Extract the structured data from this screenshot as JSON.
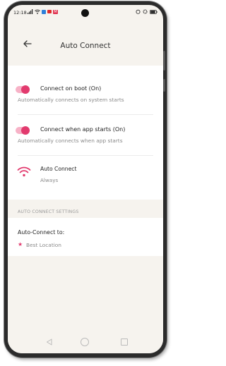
{
  "status_bar": {
    "time": "12:18",
    "notification_badge": "M"
  },
  "header": {
    "title": "Auto Connect",
    "back_icon": "arrow-left-icon"
  },
  "settings": {
    "connect_on_boot": {
      "label": "Connect on boot (On)",
      "description": "Automatically connects on system starts",
      "enabled": true
    },
    "connect_on_app_start": {
      "label": "Connect when app starts (On)",
      "description": "Automatically connects when app starts",
      "enabled": true
    },
    "auto_connect": {
      "label": "Auto Connect",
      "value": "Always",
      "icon": "wifi-icon"
    }
  },
  "section": {
    "label": "AUTO CONNECT SETTINGS"
  },
  "auto_connect_to": {
    "label": "Auto-Connect to:",
    "value": "Best Location",
    "icon": "star-icon"
  },
  "colors": {
    "accent": "#e23a6e",
    "toggle_track": "#f7b2c7",
    "background": "#f6f3ee"
  }
}
